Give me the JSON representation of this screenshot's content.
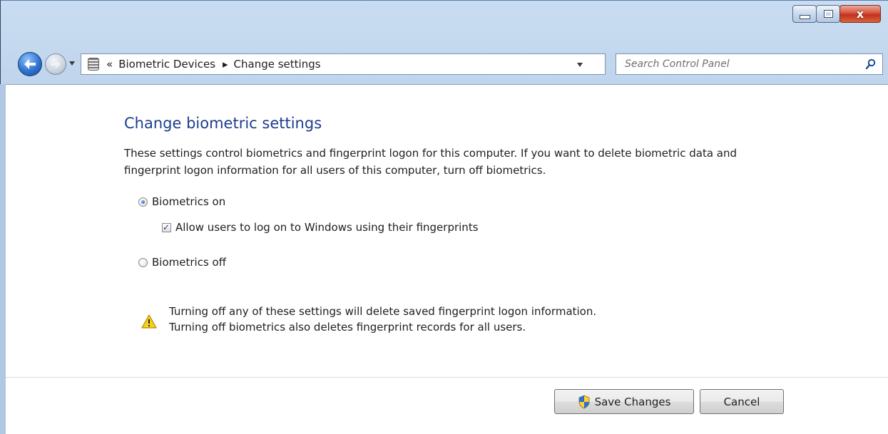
{
  "window": {
    "caption_buttons": {
      "close_glyph": "x"
    },
    "colors": {
      "accent": "#1e3d8f",
      "close": "#c2311a",
      "frame": "#b8cfe9"
    }
  },
  "navbar": {
    "back_icon": "back-arrow-icon",
    "forward_icon": "forward-arrow-icon",
    "address": {
      "chevron": "«",
      "breadcrumbs": [
        "Biometric Devices",
        "Change settings"
      ],
      "separator": "▸"
    },
    "search": {
      "placeholder": "Search Control Panel"
    }
  },
  "main": {
    "title": "Change biometric settings",
    "description": "These settings control biometrics and fingerprint logon for this computer. If you want to delete biometric data and fingerprint logon information for all users of this computer, turn off biometrics.",
    "options": {
      "on_label": "Biometrics on",
      "allow_label": "Allow users to log on to Windows using their fingerprints",
      "off_label": "Biometrics off",
      "selected": "on",
      "allow_checked": true
    },
    "warning": {
      "line1": "Turning off any of these settings will delete saved fingerprint logon information.",
      "line2": "Turning off biometrics also deletes fingerprint records for all users."
    }
  },
  "buttons": {
    "save": "Save Changes",
    "cancel": "Cancel"
  }
}
